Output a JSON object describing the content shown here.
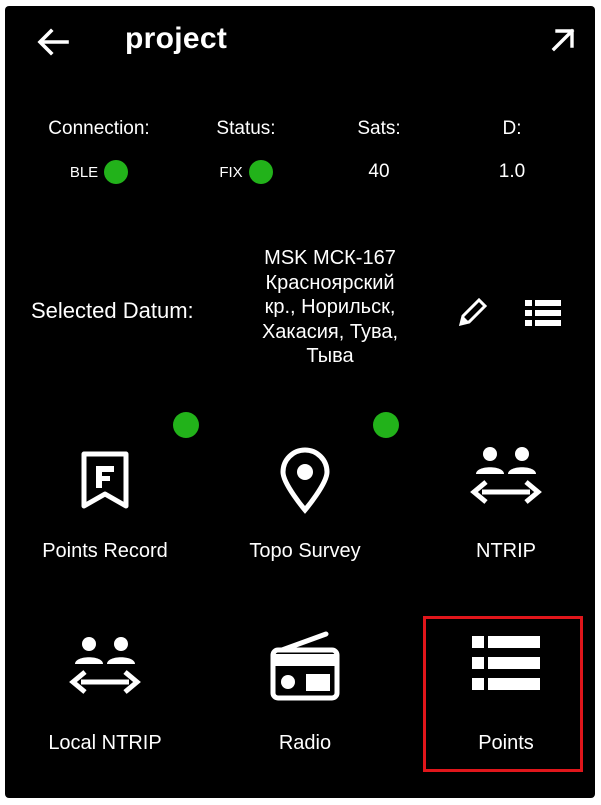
{
  "header": {
    "title": "project",
    "back_icon": "arrow-left-icon",
    "open_icon": "arrow-up-right-icon"
  },
  "status": {
    "connection": {
      "label": "Connection:",
      "value": "BLE",
      "indicator_color": "#22b21a"
    },
    "status": {
      "label": "Status:",
      "value": "FIX",
      "indicator_color": "#22b21a"
    },
    "sats": {
      "label": "Sats:",
      "value": "40"
    },
    "d": {
      "label": "D:",
      "value": "1.0"
    }
  },
  "datum": {
    "label": "Selected Datum:",
    "lines": [
      "MSK МСК-167",
      "Красноярский",
      "кр., Норильск,",
      "Хакасия, Тува,",
      "Тыва"
    ],
    "edit_icon": "pencil-icon",
    "list_icon": "list-icon"
  },
  "tiles": [
    {
      "label": "Points Record",
      "icon": "flag-bookmark-icon",
      "badge": true
    },
    {
      "label": "Topo Survey",
      "icon": "map-pin-icon",
      "badge": true
    },
    {
      "label": "NTRIP",
      "icon": "people-exchange-icon",
      "badge": false
    },
    {
      "label": "Local NTRIP",
      "icon": "people-exchange-icon",
      "badge": false
    },
    {
      "label": "Radio",
      "icon": "radio-icon",
      "badge": false
    },
    {
      "label": "Points",
      "icon": "list-icon",
      "badge": false,
      "highlighted": true
    }
  ],
  "colors": {
    "background": "#000000",
    "text": "#ffffff",
    "indicator": "#22b21a",
    "highlight": "#e0161b"
  }
}
